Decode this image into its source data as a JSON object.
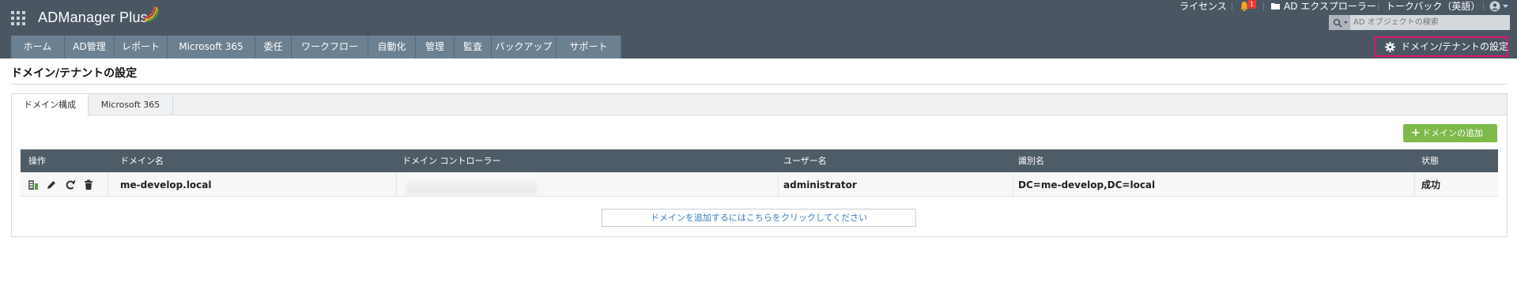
{
  "app": {
    "title": "ADManager Plus"
  },
  "utility": {
    "license": "ライセンス",
    "notification_count": "1",
    "ad_explorer": "AD エクスプローラー",
    "talkback": "トークバック（英語）"
  },
  "search": {
    "placeholder": "AD オブジェクトの検索"
  },
  "nav": {
    "items": [
      "ホーム",
      "AD管理",
      "レポート",
      "Microsoft 365",
      "委任",
      "ワークフロー",
      "自動化",
      "管理",
      "監査",
      "バックアップ",
      "サポート"
    ]
  },
  "settings_button": {
    "label": "ドメイン/テナントの設定"
  },
  "page": {
    "title": "ドメイン/テナントの設定"
  },
  "tabs": [
    {
      "label": "ドメイン構成",
      "active": true
    },
    {
      "label": "Microsoft 365",
      "active": false
    }
  ],
  "add_domain_button": {
    "label": "ドメインの追加"
  },
  "table": {
    "headers": [
      "操作",
      "ドメイン名",
      "ドメイン コントローラー",
      "ユーザー名",
      "識別名",
      "状態"
    ],
    "rows": [
      {
        "domain": "me-develop.local",
        "controller": "",
        "user": "administrator",
        "dn": "DC=me-develop,DC=local",
        "status": "成功"
      }
    ]
  },
  "add_domain_link": {
    "label": "ドメインを追加するにはこちらをクリックしてください"
  },
  "colors": {
    "header_bg": "#4a5763",
    "nav_bg": "#6b8090",
    "table_header_bg": "#4e5c68",
    "accent_green": "#7dba4a",
    "highlight_border": "#e3136b",
    "link_blue": "#3b7bc3"
  }
}
